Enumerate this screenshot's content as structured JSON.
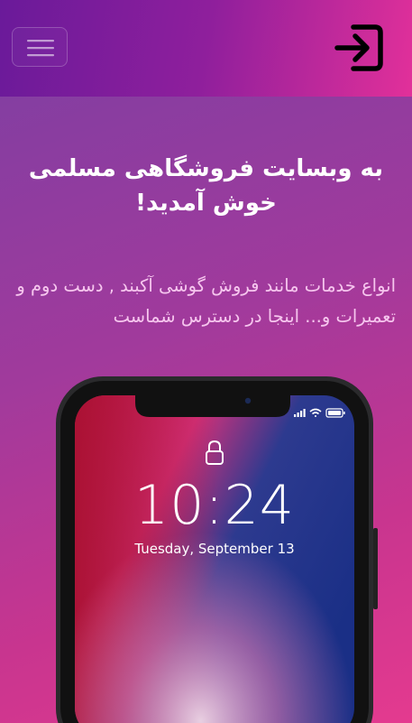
{
  "navbar": {
    "menu_icon": "hamburger-menu-icon",
    "login_icon": "sign-in-icon"
  },
  "hero": {
    "title": "به وبسایت فروشگاهی مسلمی خوش آمدید!",
    "description": "انواع خدمات مانند فروش گوشی آکبند , دست دوم و تعمیرات و... اینجا در دسترس شماست"
  },
  "phone": {
    "time": "10:24",
    "date": "Tuesday, September 13",
    "icons": [
      "lock-icon",
      "signal-icon",
      "wifi-icon",
      "battery-icon"
    ]
  },
  "colors": {
    "navbar_start": "#6a1a9a",
    "navbar_end": "#e2309a",
    "description_text": "#f6c6ee"
  }
}
